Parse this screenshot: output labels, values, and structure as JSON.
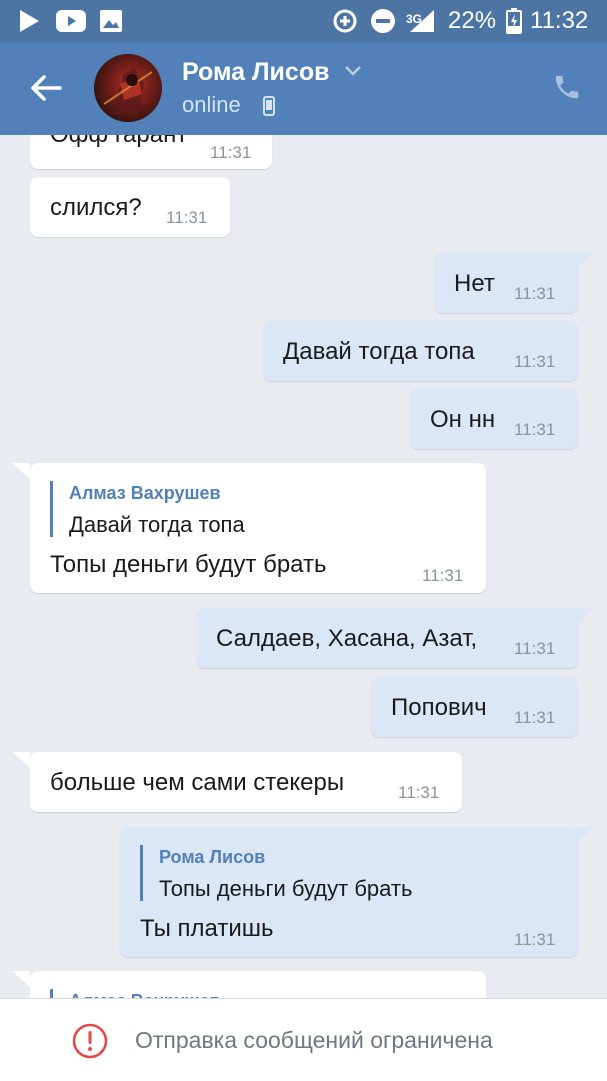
{
  "status_bar": {
    "battery": "22%",
    "time": "11:32",
    "network": "3G",
    "icons": [
      "play-store-icon",
      "youtube-icon",
      "gallery-icon",
      "data-saver-icon",
      "do-not-disturb-icon",
      "signal-icon",
      "battery-icon"
    ]
  },
  "header": {
    "name": "Рома Лисов",
    "status": "online",
    "icons": [
      "back-arrow-icon",
      "avatar",
      "chevron-down-icon",
      "mobile-phone-icon",
      "call-icon"
    ]
  },
  "messages": [
    {
      "dir": "in",
      "text": "Офф гарант",
      "time": "11:31"
    },
    {
      "dir": "in",
      "text": "слился?",
      "time": "11:31"
    },
    {
      "dir": "out",
      "text": "Нет",
      "time": "11:31"
    },
    {
      "dir": "out",
      "text": "Давай тогда топа",
      "time": "11:31"
    },
    {
      "dir": "out",
      "text": "Он нн",
      "time": "11:31"
    },
    {
      "dir": "in",
      "quote": {
        "author": "Алмаз Вахрушев",
        "text": "Давай тогда топа"
      },
      "text": "Топы деньги будут брать",
      "time": "11:31"
    },
    {
      "dir": "out",
      "text": "Салдаев, Хасана, Азат,",
      "time": "11:31"
    },
    {
      "dir": "out",
      "text": "Попович",
      "time": "11:31"
    },
    {
      "dir": "in",
      "text": "больше чем сами стекеры",
      "time": "11:31"
    },
    {
      "dir": "out",
      "quote": {
        "author": "Рома Лисов",
        "text": "Топы деньги будут брать"
      },
      "text": "Ты платишь",
      "time": "11:31"
    },
    {
      "dir": "in",
      "quote": {
        "author": "Алмаз Вахрушев",
        "text": ""
      },
      "text": "",
      "time": ""
    }
  ],
  "bottom_bar": {
    "text": "Отправка сообщений ограничена",
    "icon": "warning-icon"
  },
  "colors": {
    "header": "#5181b8",
    "status_bar": "#4c75a3",
    "incoming": "#ffffff",
    "outgoing": "#dbe7f7",
    "background": "#e8ecf1",
    "warning": "#e64646"
  }
}
